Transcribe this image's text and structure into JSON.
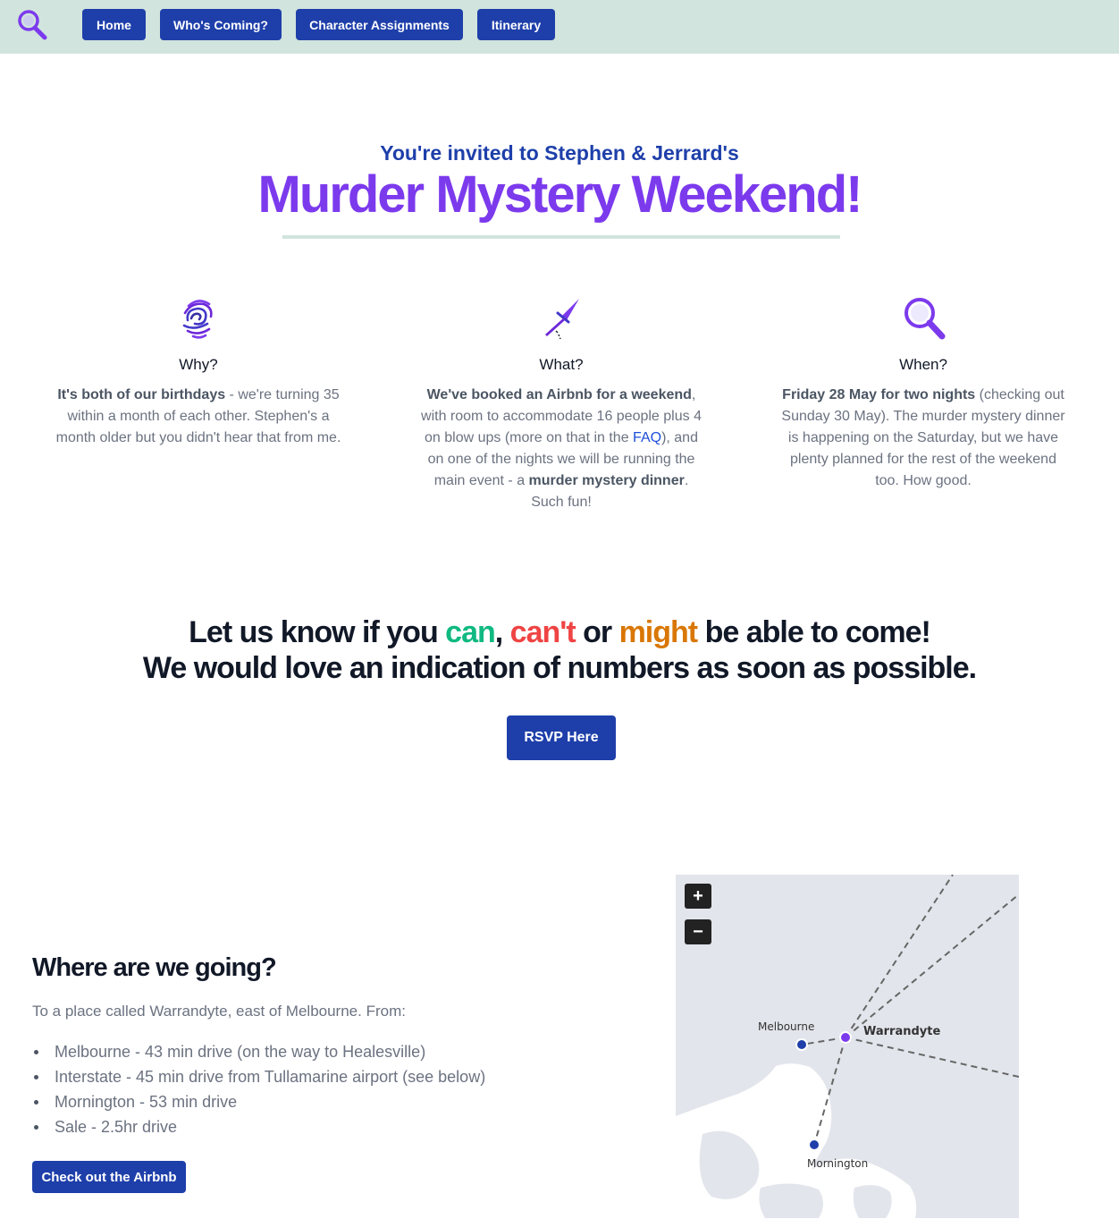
{
  "nav": {
    "items": [
      {
        "label": "Home"
      },
      {
        "label": "Who's Coming?"
      },
      {
        "label": "Character Assignments"
      },
      {
        "label": "Itinerary"
      }
    ]
  },
  "hero": {
    "subtitle": "You're invited to Stephen & Jerrard's",
    "title": "Murder Mystery Weekend!"
  },
  "features": [
    {
      "icon": "fingerprint-icon",
      "title": "Why?",
      "bold": "It's both of our birthdays",
      "text": " - we're turning 35 within a month of each other. Stephen's a month older but you didn't hear that from me."
    },
    {
      "icon": "knife-icon",
      "title": "What?",
      "bold": "We've booked an Airbnb for a weekend",
      "text": ", with room to accommodate 16 people plus 4 on blow ups (more on that in the ",
      "link": "FAQ",
      "text2": "), and on one of the nights we will be running the main event - a ",
      "bold2": "murder mystery dinner",
      "text3": ". Such fun!"
    },
    {
      "icon": "magnifier-icon",
      "title": "When?",
      "bold": "Friday 28 May for two nights",
      "text": " (checking out Sunday 30 May). The murder mystery dinner is happening on the Saturday, but we have plenty planned for the rest of the weekend too. How good."
    }
  ],
  "rsvp": {
    "line1_start": "Let us know if you ",
    "can": "can",
    "comma": ", ",
    "cant": "can't",
    "or": " or ",
    "might": "might",
    "line1_end": " be able to come!",
    "line2": "We would love an indication of numbers as soon as possible.",
    "button": "RSVP Here"
  },
  "where": {
    "title": "Where are we going?",
    "intro": "To a place called Warrandyte, east of Melbourne. From:",
    "items": [
      "Melbourne - 43 min drive (on the way to Healesville)",
      "Interstate - 45 min drive from Tullamarine airport (see below)",
      "Mornington - 53 min drive",
      "Sale - 2.5hr drive"
    ],
    "button": "Check out the Airbnb"
  },
  "map": {
    "zoom_in": "+",
    "zoom_out": "−",
    "places": {
      "melbourne": "Melbourne",
      "warrandyte": "Warrandyte",
      "mornington": "Mornington"
    }
  },
  "colors": {
    "nav_bg": "#d1e4dd",
    "primary": "#1e3faa",
    "accent": "#7c3aed",
    "can": "#10b981",
    "cant": "#ef4444",
    "might": "#d97706"
  }
}
